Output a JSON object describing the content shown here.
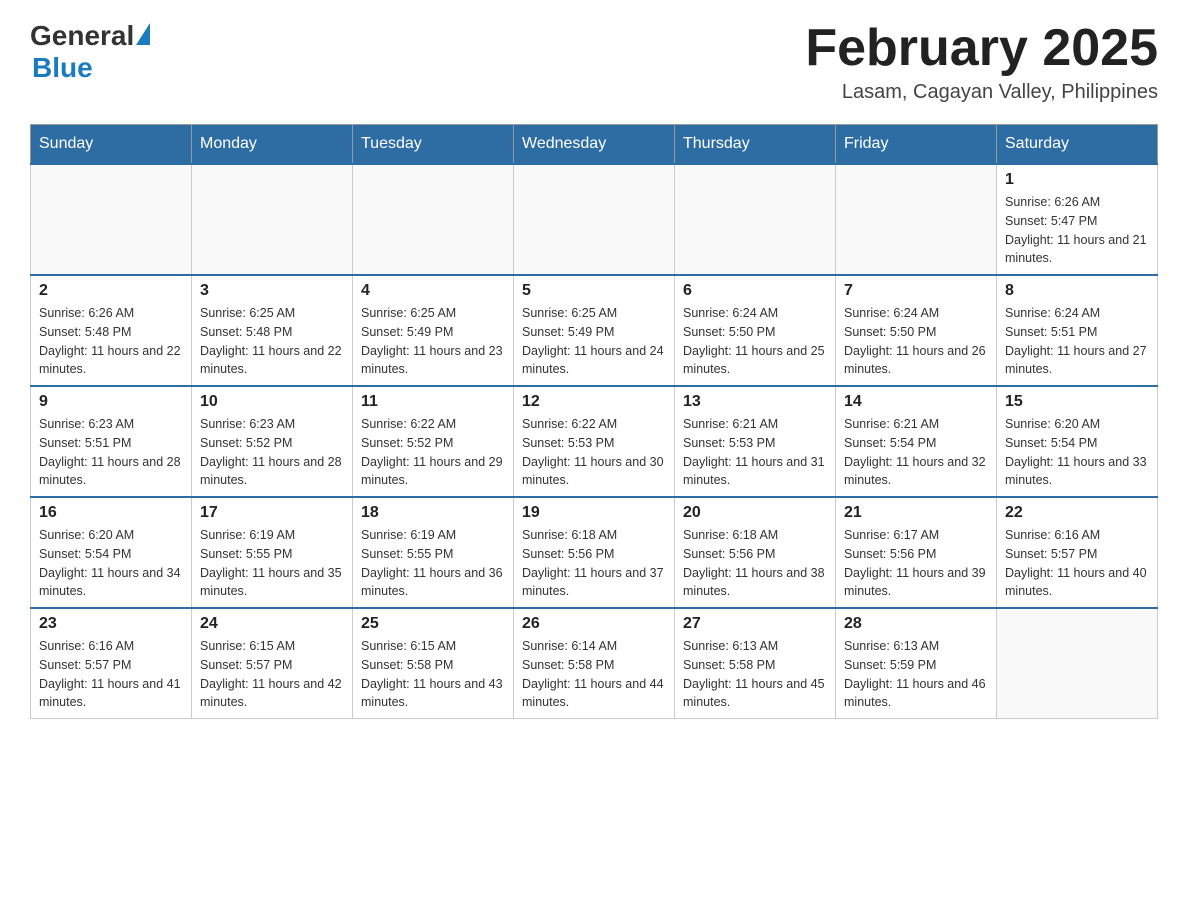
{
  "logo": {
    "general": "General",
    "blue": "Blue"
  },
  "header": {
    "month_title": "February 2025",
    "location": "Lasam, Cagayan Valley, Philippines"
  },
  "weekdays": [
    "Sunday",
    "Monday",
    "Tuesday",
    "Wednesday",
    "Thursday",
    "Friday",
    "Saturday"
  ],
  "weeks": [
    [
      {
        "day": "",
        "info": ""
      },
      {
        "day": "",
        "info": ""
      },
      {
        "day": "",
        "info": ""
      },
      {
        "day": "",
        "info": ""
      },
      {
        "day": "",
        "info": ""
      },
      {
        "day": "",
        "info": ""
      },
      {
        "day": "1",
        "info": "Sunrise: 6:26 AM\nSunset: 5:47 PM\nDaylight: 11 hours and 21 minutes."
      }
    ],
    [
      {
        "day": "2",
        "info": "Sunrise: 6:26 AM\nSunset: 5:48 PM\nDaylight: 11 hours and 22 minutes."
      },
      {
        "day": "3",
        "info": "Sunrise: 6:25 AM\nSunset: 5:48 PM\nDaylight: 11 hours and 22 minutes."
      },
      {
        "day": "4",
        "info": "Sunrise: 6:25 AM\nSunset: 5:49 PM\nDaylight: 11 hours and 23 minutes."
      },
      {
        "day": "5",
        "info": "Sunrise: 6:25 AM\nSunset: 5:49 PM\nDaylight: 11 hours and 24 minutes."
      },
      {
        "day": "6",
        "info": "Sunrise: 6:24 AM\nSunset: 5:50 PM\nDaylight: 11 hours and 25 minutes."
      },
      {
        "day": "7",
        "info": "Sunrise: 6:24 AM\nSunset: 5:50 PM\nDaylight: 11 hours and 26 minutes."
      },
      {
        "day": "8",
        "info": "Sunrise: 6:24 AM\nSunset: 5:51 PM\nDaylight: 11 hours and 27 minutes."
      }
    ],
    [
      {
        "day": "9",
        "info": "Sunrise: 6:23 AM\nSunset: 5:51 PM\nDaylight: 11 hours and 28 minutes."
      },
      {
        "day": "10",
        "info": "Sunrise: 6:23 AM\nSunset: 5:52 PM\nDaylight: 11 hours and 28 minutes."
      },
      {
        "day": "11",
        "info": "Sunrise: 6:22 AM\nSunset: 5:52 PM\nDaylight: 11 hours and 29 minutes."
      },
      {
        "day": "12",
        "info": "Sunrise: 6:22 AM\nSunset: 5:53 PM\nDaylight: 11 hours and 30 minutes."
      },
      {
        "day": "13",
        "info": "Sunrise: 6:21 AM\nSunset: 5:53 PM\nDaylight: 11 hours and 31 minutes."
      },
      {
        "day": "14",
        "info": "Sunrise: 6:21 AM\nSunset: 5:54 PM\nDaylight: 11 hours and 32 minutes."
      },
      {
        "day": "15",
        "info": "Sunrise: 6:20 AM\nSunset: 5:54 PM\nDaylight: 11 hours and 33 minutes."
      }
    ],
    [
      {
        "day": "16",
        "info": "Sunrise: 6:20 AM\nSunset: 5:54 PM\nDaylight: 11 hours and 34 minutes."
      },
      {
        "day": "17",
        "info": "Sunrise: 6:19 AM\nSunset: 5:55 PM\nDaylight: 11 hours and 35 minutes."
      },
      {
        "day": "18",
        "info": "Sunrise: 6:19 AM\nSunset: 5:55 PM\nDaylight: 11 hours and 36 minutes."
      },
      {
        "day": "19",
        "info": "Sunrise: 6:18 AM\nSunset: 5:56 PM\nDaylight: 11 hours and 37 minutes."
      },
      {
        "day": "20",
        "info": "Sunrise: 6:18 AM\nSunset: 5:56 PM\nDaylight: 11 hours and 38 minutes."
      },
      {
        "day": "21",
        "info": "Sunrise: 6:17 AM\nSunset: 5:56 PM\nDaylight: 11 hours and 39 minutes."
      },
      {
        "day": "22",
        "info": "Sunrise: 6:16 AM\nSunset: 5:57 PM\nDaylight: 11 hours and 40 minutes."
      }
    ],
    [
      {
        "day": "23",
        "info": "Sunrise: 6:16 AM\nSunset: 5:57 PM\nDaylight: 11 hours and 41 minutes."
      },
      {
        "day": "24",
        "info": "Sunrise: 6:15 AM\nSunset: 5:57 PM\nDaylight: 11 hours and 42 minutes."
      },
      {
        "day": "25",
        "info": "Sunrise: 6:15 AM\nSunset: 5:58 PM\nDaylight: 11 hours and 43 minutes."
      },
      {
        "day": "26",
        "info": "Sunrise: 6:14 AM\nSunset: 5:58 PM\nDaylight: 11 hours and 44 minutes."
      },
      {
        "day": "27",
        "info": "Sunrise: 6:13 AM\nSunset: 5:58 PM\nDaylight: 11 hours and 45 minutes."
      },
      {
        "day": "28",
        "info": "Sunrise: 6:13 AM\nSunset: 5:59 PM\nDaylight: 11 hours and 46 minutes."
      },
      {
        "day": "",
        "info": ""
      }
    ]
  ]
}
